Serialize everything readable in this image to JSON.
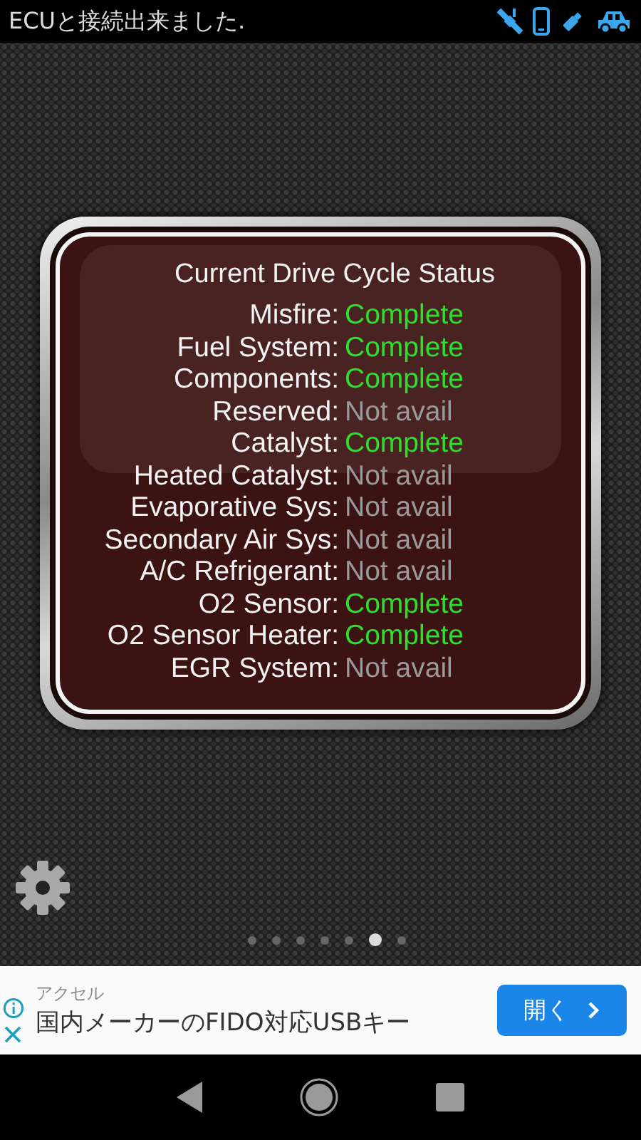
{
  "status_bar": {
    "message": "ECUと接続出来ました."
  },
  "panel": {
    "title": "Current Drive Cycle Status",
    "rows": [
      {
        "label": "Misfire:",
        "value": "Complete",
        "kind": "complete"
      },
      {
        "label": "Fuel System:",
        "value": "Complete",
        "kind": "complete"
      },
      {
        "label": "Components:",
        "value": "Complete",
        "kind": "complete"
      },
      {
        "label": "Reserved:",
        "value": "Not avail",
        "kind": "unavailable"
      },
      {
        "label": "Catalyst:",
        "value": "Complete",
        "kind": "complete"
      },
      {
        "label": "Heated Catalyst:",
        "value": "Not avail",
        "kind": "unavailable"
      },
      {
        "label": "Evaporative Sys:",
        "value": "Not avail",
        "kind": "unavailable"
      },
      {
        "label": "Secondary Air Sys:",
        "value": "Not avail",
        "kind": "unavailable"
      },
      {
        "label": "A/C Refrigerant:",
        "value": "Not avail",
        "kind": "unavailable"
      },
      {
        "label": "O2 Sensor:",
        "value": "Complete",
        "kind": "complete"
      },
      {
        "label": "O2 Sensor Heater:",
        "value": "Complete",
        "kind": "complete"
      },
      {
        "label": "EGR System:",
        "value": "Not avail",
        "kind": "unavailable"
      }
    ]
  },
  "pages": [
    {
      "selected": false
    },
    {
      "selected": false
    },
    {
      "selected": false
    },
    {
      "selected": false
    },
    {
      "selected": false
    },
    {
      "selected": true
    },
    {
      "selected": false
    }
  ],
  "ad": {
    "advertiser": "アクセル",
    "headline": "国内メーカーのFIDO対応USBキー",
    "button": "開く"
  }
}
